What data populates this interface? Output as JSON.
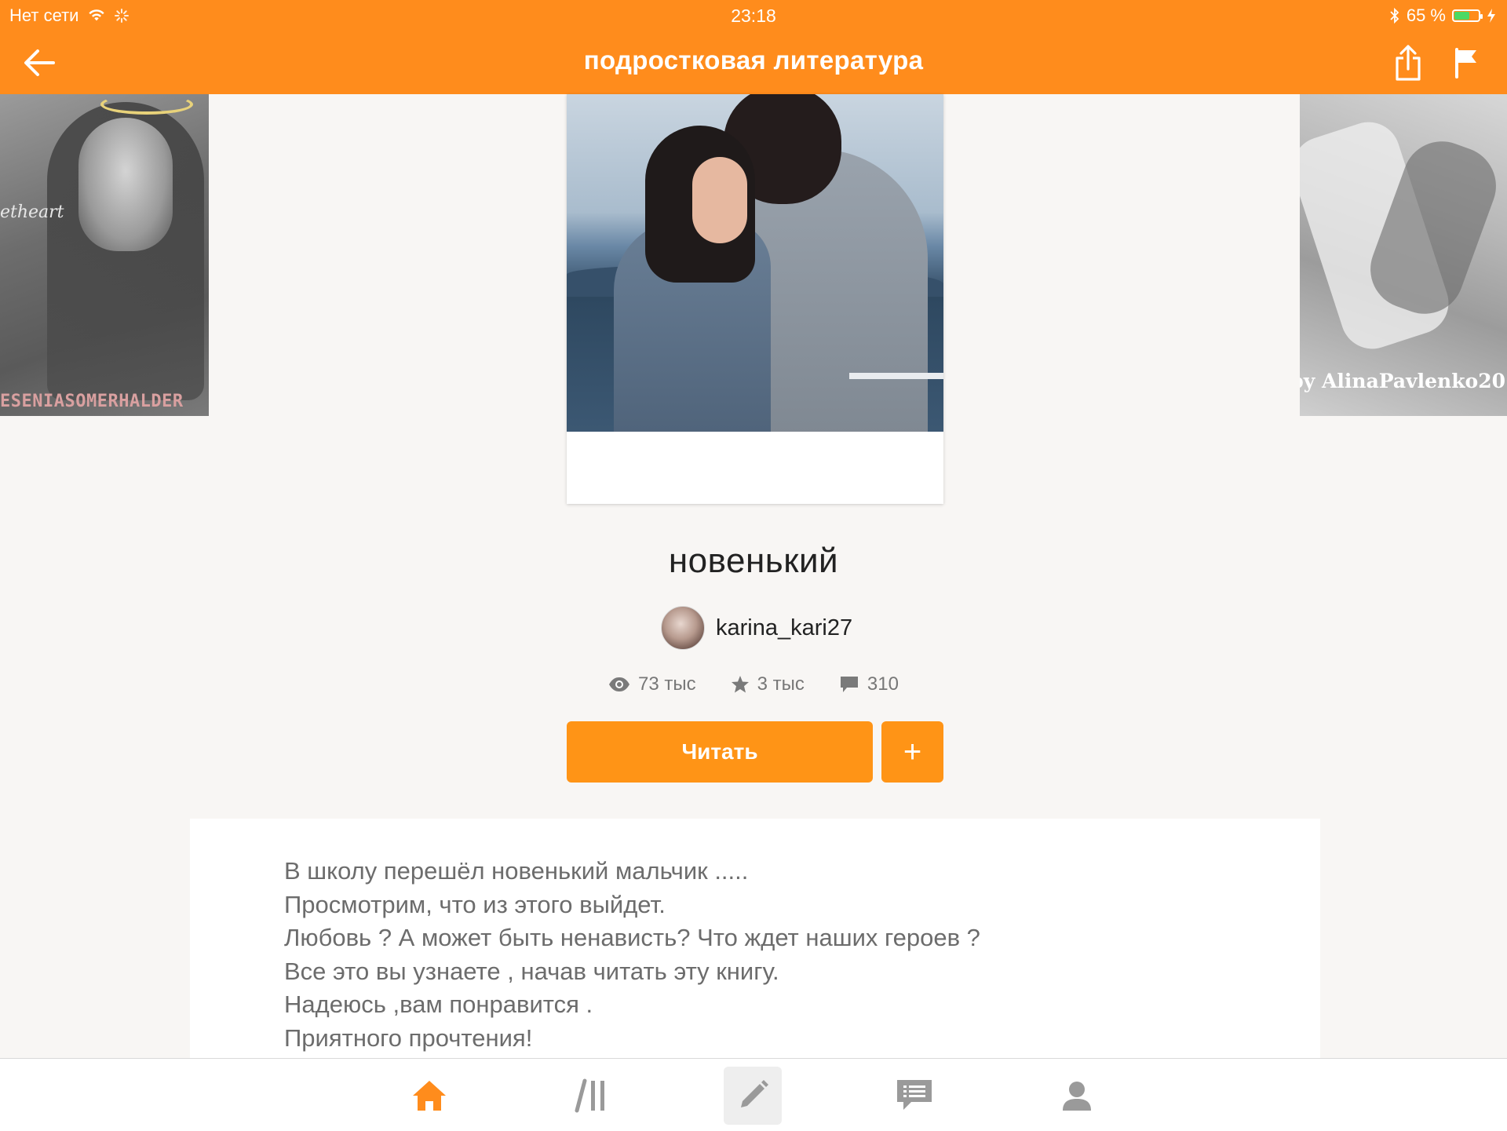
{
  "status_bar": {
    "carrier": "Нет сети",
    "time": "23:18",
    "battery_percent": "65 %",
    "battery_level": 0.65
  },
  "nav": {
    "title": "подростковая литература"
  },
  "carousel": {
    "left_cover_text": "ESENIASOMERHALDER",
    "left_cover_subtext": "etheart",
    "right_cover_text": "by AlinaPavlenko20"
  },
  "book": {
    "title": "новенький",
    "author": "karina_kari27",
    "views": "73 тыс",
    "votes": "3 тыс",
    "comments": "310",
    "read_label": "Читать",
    "add_label": "+"
  },
  "description": [
    "В школу перешёл новенький мальчик .....",
    "Просмотрим, что из этого выйдет.",
    "Любовь ? А может быть ненависть? Что ждет наших героев ?",
    "Все это вы узнаете , начав читать эту книгу.",
    "Надеюсь ,вам понравится .",
    "Приятного прочтения!"
  ],
  "tabs": [
    {
      "name": "home",
      "icon": "home-icon",
      "active": true
    },
    {
      "name": "library",
      "icon": "library-icon",
      "active": false
    },
    {
      "name": "write",
      "icon": "pencil-icon",
      "active": false
    },
    {
      "name": "messages",
      "icon": "message-icon",
      "active": false
    },
    {
      "name": "profile",
      "icon": "profile-icon",
      "active": false
    }
  ],
  "colors": {
    "accent": "#ff8c1c",
    "button": "#ff9416",
    "active_tab": "#ff8c1c",
    "inactive_tab": "#9a9a9a"
  }
}
